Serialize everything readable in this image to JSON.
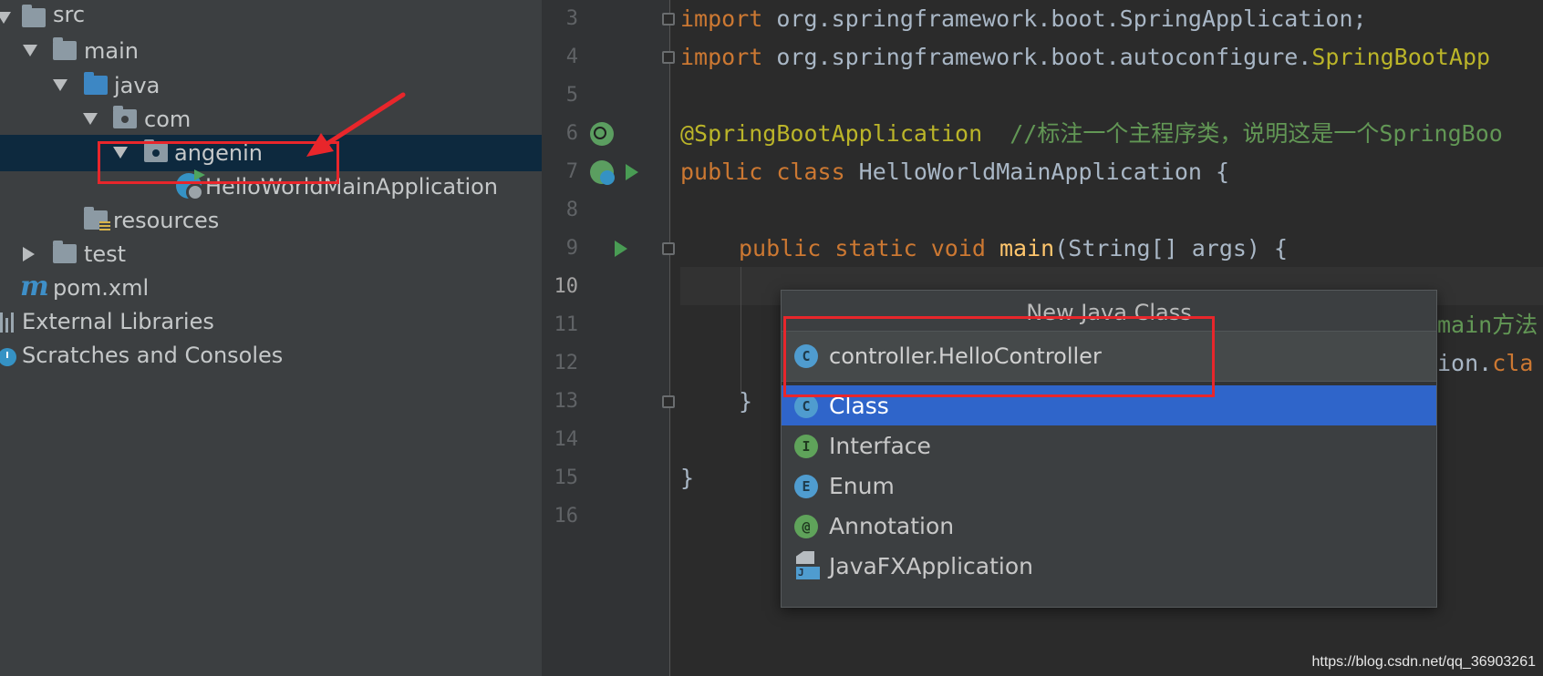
{
  "project_tree": {
    "items": [
      {
        "label": "src"
      },
      {
        "label": "main"
      },
      {
        "label": "java"
      },
      {
        "label": "com"
      },
      {
        "label": "angenin"
      },
      {
        "label": "HelloWorldMainApplication"
      },
      {
        "label": "resources"
      },
      {
        "label": "test"
      },
      {
        "label": "pom.xml"
      },
      {
        "label": "External Libraries"
      },
      {
        "label": "Scratches and Consoles"
      }
    ]
  },
  "editor": {
    "line_numbers": [
      "3",
      "4",
      "5",
      "6",
      "7",
      "8",
      "9",
      "10",
      "11",
      "12",
      "13",
      "14",
      "15",
      "16"
    ],
    "lines": {
      "l3_kw": "import",
      "l3_rest": " org.springframework.boot.SpringApplication;",
      "l4_kw": "import",
      "l4_rest": " org.springframework.boot.autoconfigure.",
      "l4_cls": "SpringBootApp",
      "l6_ann": "@SpringBootApplication",
      "l6_cm": "  //标注一个主程序类，说明这是一个SpringBoo",
      "l7_kw": "public class",
      "l7_rest": " HelloWorldMainApplication {",
      "l9_kw": "public static void",
      "l9_fn": "main",
      "l9_rest": "(String[] args) {",
      "l11_cm": "main方法",
      "l12_rest": "ion.",
      "l12_kw": "cla",
      "l13": "}",
      "l15": "}"
    }
  },
  "popup": {
    "title": "New Java Class",
    "input_value": "controller.HelloController",
    "options": [
      {
        "label": "Class",
        "icon": "C",
        "selected": true
      },
      {
        "label": "Interface",
        "icon": "I",
        "selected": false
      },
      {
        "label": "Enum",
        "icon": "E",
        "selected": false
      },
      {
        "label": "Annotation",
        "icon": "@",
        "selected": false
      },
      {
        "label": "JavaFXApplication",
        "icon": "J",
        "selected": false
      }
    ]
  },
  "colors": {
    "selection": "#2f65ca",
    "annotation_red": "#e8262b",
    "keyword": "#cc7832",
    "comment": "#629755"
  },
  "watermark": "https://blog.csdn.net/qq_36903261"
}
